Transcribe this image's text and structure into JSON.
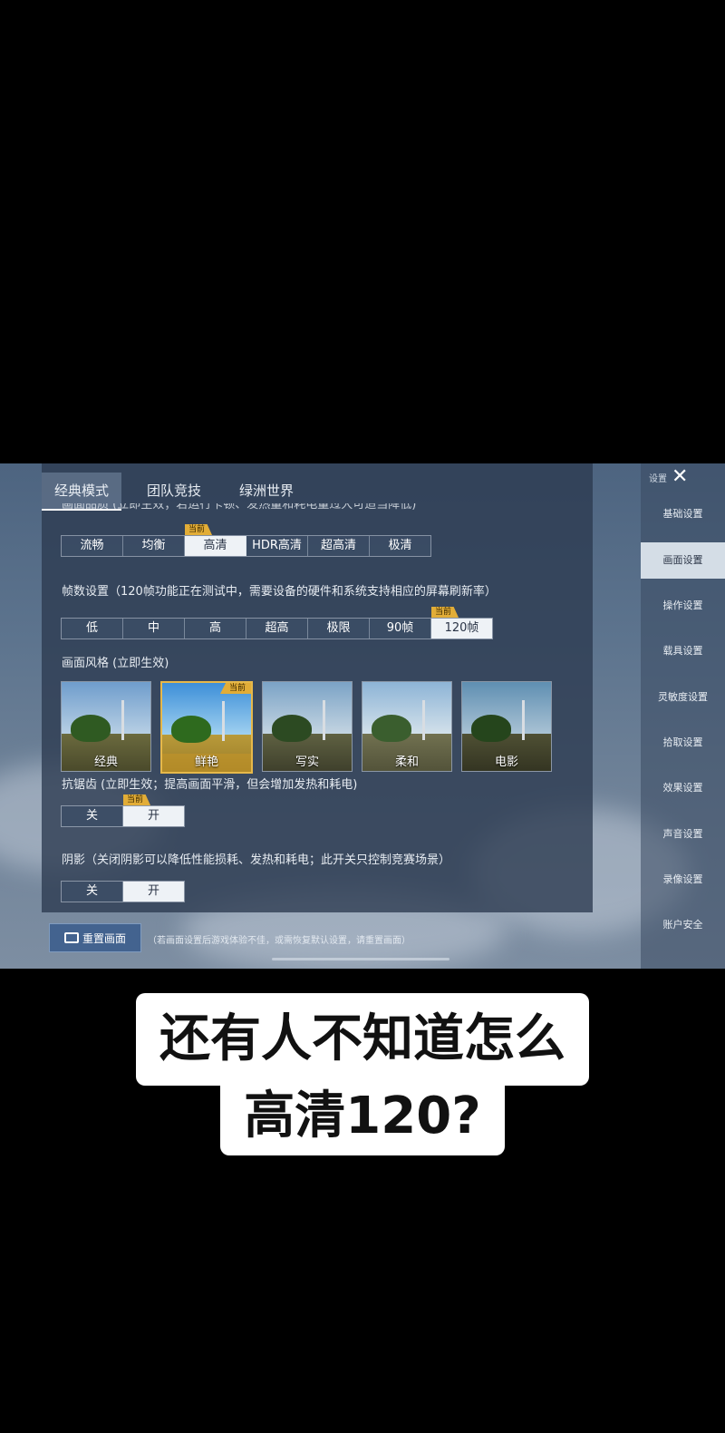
{
  "tabs": [
    "经典模式",
    "团队竞技",
    "绿洲世界"
  ],
  "quality": {
    "label": "画面品质 (立即生效；若运行卡顿、发热量和耗电量过大可适当降低)",
    "options": [
      "流畅",
      "均衡",
      "高清",
      "HDR高清",
      "超高清",
      "极清"
    ],
    "selected": "高清"
  },
  "current_badge": "当前",
  "framerate": {
    "label": "帧数设置（120帧功能正在测试中，需要设备的硬件和系统支持相应的屏幕刷新率）",
    "options": [
      "低",
      "中",
      "高",
      "超高",
      "极限",
      "90帧",
      "120帧"
    ],
    "selected": "120帧"
  },
  "style": {
    "label": "画面风格 (立即生效)",
    "options": [
      "经典",
      "鲜艳",
      "写实",
      "柔和",
      "电影"
    ],
    "selected": "鲜艳"
  },
  "antialias": {
    "label": "抗锯齿 (立即生效；提高画面平滑，但会增加发热和耗电)",
    "options": [
      "关",
      "开"
    ],
    "selected": "开"
  },
  "shadow": {
    "label": "阴影（关闭阴影可以降低性能损耗、发热和耗电；此开关只控制竞赛场景）",
    "options": [
      "关",
      "开"
    ]
  },
  "sidebar": {
    "header": "设置",
    "items": [
      "基础设置",
      "画面设置",
      "操作设置",
      "载具设置",
      "灵敏度设置",
      "拾取设置",
      "效果设置",
      "声音设置",
      "录像设置",
      "账户安全"
    ],
    "active": "画面设置"
  },
  "reset": {
    "label": "重置画面",
    "note": "（若画面设置后游戏体验不佳，或需恢复默认设置，请重置画面）"
  },
  "caption": {
    "line1": "还有人不知道怎么",
    "line2": "高清120?"
  },
  "colors": {
    "accent_gold": "#e2ad37",
    "panel": "#2b3a50"
  }
}
